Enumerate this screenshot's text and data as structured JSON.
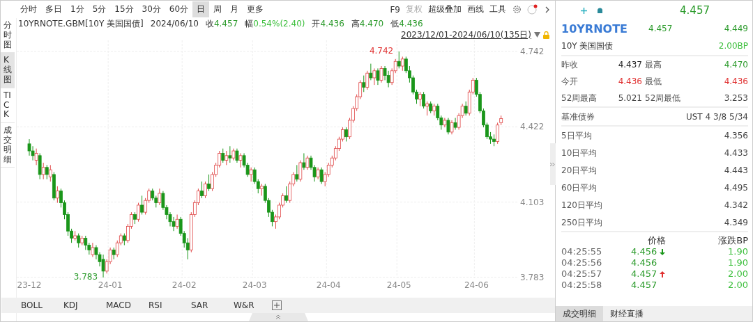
{
  "toolbar": {
    "periods": [
      {
        "label": "分时",
        "selected": false
      },
      {
        "label": "多日",
        "selected": false
      },
      {
        "label": "1分",
        "selected": false
      },
      {
        "label": "5分",
        "selected": false
      },
      {
        "label": "15分",
        "selected": false
      },
      {
        "label": "30分",
        "selected": false
      },
      {
        "label": "60分",
        "selected": false
      },
      {
        "label": "日",
        "selected": true
      },
      {
        "label": "周",
        "selected": false
      },
      {
        "label": "月",
        "selected": false
      },
      {
        "label": "更多",
        "selected": false
      }
    ],
    "tools": [
      {
        "label": "F9",
        "disabled": false
      },
      {
        "label": "复权",
        "disabled": true
      },
      {
        "label": "超级叠加",
        "disabled": false
      },
      {
        "label": "画线",
        "disabled": false
      },
      {
        "label": "工具",
        "disabled": false
      }
    ]
  },
  "side_tabs": [
    {
      "label": "分时图",
      "selected": false
    },
    {
      "label": "K线图",
      "selected": true
    },
    {
      "label": "TICK",
      "selected": false
    },
    {
      "label": "成交明细",
      "selected": false
    }
  ],
  "quote_line": {
    "symbol": "10YRNOTE.GBM[10Y 美国国债]",
    "date": "2024/06/10",
    "fields": [
      {
        "label": "收",
        "value": "4.457",
        "color": "#2a9a2a"
      },
      {
        "label": "幅",
        "value": "0.54%(2.40)",
        "color": "#3cbf3c"
      },
      {
        "label": "开",
        "value": "4.436",
        "color": "#2a9a2a"
      },
      {
        "label": "高",
        "value": "4.470",
        "color": "#2a9a2a"
      },
      {
        "label": "低",
        "value": "4.436",
        "color": "#2a9a2a"
      }
    ]
  },
  "range": "2023/12/01-2024/06/10(135日)",
  "chart_data": {
    "type": "candlestick",
    "ylim": [
      3.783,
      4.742
    ],
    "yticks": [
      {
        "value": 4.742,
        "label": "4.742"
      },
      {
        "value": 4.422,
        "label": "4.422"
      },
      {
        "value": 4.103,
        "label": "4.103"
      },
      {
        "value": 3.783,
        "label": "3.783"
      }
    ],
    "annotations": [
      "4.742",
      "3.783"
    ],
    "categories": [
      "23-12",
      null,
      null,
      null,
      null,
      null,
      null,
      null,
      null,
      null,
      null,
      null,
      null,
      null,
      null,
      null,
      null,
      null,
      null,
      null,
      null,
      null,
      null,
      "24-01",
      null,
      null,
      null,
      null,
      null,
      null,
      null,
      null,
      null,
      null,
      null,
      null,
      null,
      null,
      null,
      null,
      null,
      null,
      null,
      null,
      "24-02",
      null,
      null,
      null,
      null,
      null,
      null,
      null,
      null,
      null,
      null,
      null,
      null,
      null,
      null,
      null,
      null,
      null,
      null,
      null,
      "24-03",
      null,
      null,
      null,
      null,
      null,
      null,
      null,
      null,
      null,
      null,
      null,
      null,
      null,
      null,
      null,
      null,
      null,
      null,
      null,
      null,
      "24-04",
      null,
      null,
      null,
      null,
      null,
      null,
      null,
      null,
      null,
      null,
      null,
      null,
      null,
      null,
      null,
      null,
      null,
      null,
      null,
      "24-05",
      null,
      null,
      null,
      null,
      null,
      null,
      null,
      null,
      null,
      null,
      null,
      null,
      null,
      null,
      null,
      null,
      null,
      null,
      null,
      null,
      null,
      "24-06",
      null,
      null,
      null,
      null,
      null,
      null,
      null
    ],
    "ohlc": [
      [
        4.35,
        4.37,
        4.3,
        4.32
      ],
      [
        4.32,
        4.34,
        4.28,
        4.3
      ],
      [
        4.28,
        4.33,
        4.26,
        4.31
      ],
      [
        4.3,
        4.31,
        4.2,
        4.22
      ],
      [
        4.22,
        4.27,
        4.2,
        4.25
      ],
      [
        4.25,
        4.26,
        4.2,
        4.22
      ],
      [
        4.21,
        4.26,
        4.19,
        4.24
      ],
      [
        4.22,
        4.23,
        4.11,
        4.12
      ],
      [
        4.12,
        4.17,
        4.1,
        4.15
      ],
      [
        4.15,
        4.16,
        4.08,
        4.1
      ],
      [
        4.1,
        4.11,
        4.03,
        4.05
      ],
      [
        4.05,
        4.06,
        3.96,
        3.98
      ],
      [
        3.98,
        3.99,
        3.93,
        3.95
      ],
      [
        3.95,
        3.98,
        3.94,
        3.96
      ],
      [
        3.96,
        3.97,
        3.91,
        3.93
      ],
      [
        3.93,
        3.96,
        3.92,
        3.95
      ],
      [
        3.95,
        3.96,
        3.9,
        3.92
      ],
      [
        3.92,
        3.93,
        3.88,
        3.9
      ],
      [
        3.88,
        3.93,
        3.87,
        3.91
      ],
      [
        3.91,
        3.92,
        3.86,
        3.88
      ],
      [
        3.88,
        3.89,
        3.83,
        3.85
      ],
      [
        3.86,
        3.88,
        3.783,
        3.81
      ],
      [
        3.81,
        3.86,
        3.8,
        3.85
      ],
      [
        3.85,
        3.91,
        3.84,
        3.9
      ],
      [
        3.9,
        3.91,
        3.86,
        3.88
      ],
      [
        3.88,
        3.94,
        3.87,
        3.93
      ],
      [
        3.93,
        3.97,
        3.92,
        3.96
      ],
      [
        3.96,
        3.97,
        3.92,
        3.94
      ],
      [
        3.94,
        4.01,
        3.93,
        4.0
      ],
      [
        4.0,
        4.06,
        3.99,
        4.05
      ],
      [
        4.05,
        4.06,
        4.01,
        4.03
      ],
      [
        4.03,
        4.1,
        4.02,
        4.09
      ],
      [
        4.09,
        4.13,
        4.05,
        4.06
      ],
      [
        4.06,
        4.12,
        4.05,
        4.11
      ],
      [
        4.11,
        4.16,
        4.1,
        4.15
      ],
      [
        4.15,
        4.16,
        4.11,
        4.12
      ],
      [
        4.12,
        4.13,
        4.08,
        4.1
      ],
      [
        4.1,
        4.16,
        4.09,
        4.14
      ],
      [
        4.14,
        4.15,
        4.07,
        4.08
      ],
      [
        4.08,
        4.09,
        4.03,
        4.05
      ],
      [
        4.05,
        4.06,
        4.0,
        4.02
      ],
      [
        4.02,
        4.04,
        3.98,
        4.0
      ],
      [
        4.0,
        4.05,
        3.99,
        4.03
      ],
      [
        4.03,
        4.04,
        3.96,
        3.97
      ],
      [
        3.97,
        3.98,
        3.91,
        3.93
      ],
      [
        3.93,
        3.95,
        3.86,
        3.9
      ],
      [
        3.9,
        4.06,
        3.89,
        4.05
      ],
      [
        4.05,
        4.11,
        4.04,
        4.1
      ],
      [
        4.1,
        4.16,
        4.09,
        4.15
      ],
      [
        4.15,
        4.19,
        4.12,
        4.13
      ],
      [
        4.13,
        4.19,
        4.12,
        4.18
      ],
      [
        4.18,
        4.22,
        4.15,
        4.16
      ],
      [
        4.16,
        4.23,
        4.15,
        4.22
      ],
      [
        4.22,
        4.27,
        4.21,
        4.26
      ],
      [
        4.26,
        4.32,
        4.25,
        4.31
      ],
      [
        4.31,
        4.33,
        4.27,
        4.28
      ],
      [
        4.28,
        4.32,
        4.26,
        4.3
      ],
      [
        4.3,
        4.34,
        4.27,
        4.29
      ],
      [
        4.29,
        4.33,
        4.28,
        4.32
      ],
      [
        4.32,
        4.33,
        4.27,
        4.28
      ],
      [
        4.28,
        4.31,
        4.25,
        4.3
      ],
      [
        4.3,
        4.31,
        4.25,
        4.26
      ],
      [
        4.26,
        4.27,
        4.21,
        4.22
      ],
      [
        4.22,
        4.25,
        4.19,
        4.24
      ],
      [
        4.24,
        4.25,
        4.18,
        4.19
      ],
      [
        4.19,
        4.2,
        4.14,
        4.16
      ],
      [
        4.16,
        4.18,
        4.13,
        4.17
      ],
      [
        4.17,
        4.18,
        4.1,
        4.11
      ],
      [
        4.11,
        4.12,
        4.04,
        4.06
      ],
      [
        4.06,
        4.07,
        4.0,
        4.02
      ],
      [
        4.02,
        4.05,
        3.99,
        4.04
      ],
      [
        4.04,
        4.1,
        4.03,
        4.09
      ],
      [
        4.09,
        4.14,
        4.08,
        4.13
      ],
      [
        4.13,
        4.17,
        4.1,
        4.11
      ],
      [
        4.11,
        4.19,
        4.1,
        4.18
      ],
      [
        4.18,
        4.23,
        4.17,
        4.22
      ],
      [
        4.22,
        4.26,
        4.19,
        4.2
      ],
      [
        4.2,
        4.28,
        4.19,
        4.27
      ],
      [
        4.27,
        4.31,
        4.24,
        4.25
      ],
      [
        4.25,
        4.3,
        4.24,
        4.29
      ],
      [
        4.29,
        4.3,
        4.24,
        4.25
      ],
      [
        4.25,
        4.26,
        4.19,
        4.21
      ],
      [
        4.21,
        4.25,
        4.2,
        4.24
      ],
      [
        4.24,
        4.25,
        4.18,
        4.19
      ],
      [
        4.19,
        4.23,
        4.17,
        4.22
      ],
      [
        4.22,
        4.27,
        4.21,
        4.26
      ],
      [
        4.26,
        4.3,
        4.25,
        4.29
      ],
      [
        4.29,
        4.34,
        4.28,
        4.33
      ],
      [
        4.33,
        4.38,
        4.32,
        4.37
      ],
      [
        4.37,
        4.42,
        4.36,
        4.41
      ],
      [
        4.41,
        4.42,
        4.36,
        4.38
      ],
      [
        4.38,
        4.46,
        4.37,
        4.45
      ],
      [
        4.45,
        4.51,
        4.44,
        4.5
      ],
      [
        4.5,
        4.56,
        4.49,
        4.55
      ],
      [
        4.55,
        4.62,
        4.54,
        4.61
      ],
      [
        4.61,
        4.64,
        4.57,
        4.59
      ],
      [
        4.59,
        4.66,
        4.58,
        4.65
      ],
      [
        4.65,
        4.69,
        4.62,
        4.63
      ],
      [
        4.63,
        4.67,
        4.6,
        4.66
      ],
      [
        4.66,
        4.67,
        4.6,
        4.62
      ],
      [
        4.62,
        4.68,
        4.61,
        4.67
      ],
      [
        4.67,
        4.68,
        4.62,
        4.64
      ],
      [
        4.64,
        4.66,
        4.59,
        4.61
      ],
      [
        4.61,
        4.67,
        4.6,
        4.66
      ],
      [
        4.66,
        4.71,
        4.65,
        4.7
      ],
      [
        4.7,
        4.742,
        4.67,
        4.68
      ],
      [
        4.68,
        4.72,
        4.66,
        4.71
      ],
      [
        4.71,
        4.72,
        4.65,
        4.66
      ],
      [
        4.66,
        4.68,
        4.61,
        4.63
      ],
      [
        4.63,
        4.64,
        4.56,
        4.57
      ],
      [
        4.57,
        4.58,
        4.52,
        4.54
      ],
      [
        4.54,
        4.57,
        4.51,
        4.56
      ],
      [
        4.56,
        4.57,
        4.5,
        4.51
      ],
      [
        4.51,
        4.53,
        4.47,
        4.52
      ],
      [
        4.52,
        4.53,
        4.48,
        4.49
      ],
      [
        4.49,
        4.52,
        4.47,
        4.51
      ],
      [
        4.51,
        4.52,
        4.45,
        4.46
      ],
      [
        4.46,
        4.47,
        4.41,
        4.43
      ],
      [
        4.43,
        4.46,
        4.42,
        4.45
      ],
      [
        4.45,
        4.46,
        4.39,
        4.4
      ],
      [
        4.4,
        4.45,
        4.39,
        4.44
      ],
      [
        4.44,
        4.46,
        4.41,
        4.42
      ],
      [
        4.42,
        4.48,
        4.41,
        4.47
      ],
      [
        4.47,
        4.52,
        4.46,
        4.51
      ],
      [
        4.51,
        4.53,
        4.47,
        4.48
      ],
      [
        4.48,
        4.58,
        4.47,
        4.57
      ],
      [
        4.57,
        4.63,
        4.56,
        4.62
      ],
      [
        4.62,
        4.63,
        4.55,
        4.56
      ],
      [
        4.56,
        4.57,
        4.48,
        4.49
      ],
      [
        4.49,
        4.5,
        4.42,
        4.43
      ],
      [
        4.43,
        4.44,
        4.37,
        4.38
      ],
      [
        4.38,
        4.4,
        4.35,
        4.37
      ],
      [
        4.37,
        4.39,
        4.34,
        4.36
      ],
      [
        4.36,
        4.44,
        4.35,
        4.43
      ],
      [
        4.44,
        4.47,
        4.43,
        4.457
      ]
    ]
  },
  "indicators": [
    "BOLL",
    "KDJ",
    "MACD",
    "RSI",
    "SAR",
    "W&R"
  ],
  "panel": {
    "last": "4.457",
    "name": "10YRNOTE",
    "bid": "4.457",
    "ask": "4.449",
    "subtitle": "10Y 美国国债",
    "change": "2.00BP",
    "stats": [
      {
        "label": "昨收",
        "value": "4.437",
        "color": "#222222"
      },
      {
        "label": "最高",
        "value": "4.470",
        "color": "#2a9a2a"
      },
      {
        "label": "今开",
        "value": "4.436",
        "color": "#e03030"
      },
      {
        "label": "最低",
        "value": "4.436",
        "color": "#e03030"
      },
      {
        "label": "52周最高",
        "value": "5.021",
        "color": "#444444"
      },
      {
        "label": "52周最低",
        "value": "3.253",
        "color": "#444444"
      }
    ],
    "benchmark": {
      "label": "基准债券",
      "value": "UST 4 3/8 5/34"
    },
    "averages": [
      {
        "label": "5日平均",
        "value": "4.356"
      },
      {
        "label": "10日平均",
        "value": "4.433"
      },
      {
        "label": "20日平均",
        "value": "4.443"
      },
      {
        "label": "60日平均",
        "value": "4.495"
      },
      {
        "label": "120日平均",
        "value": "4.342"
      },
      {
        "label": "250日平均",
        "value": "4.349"
      }
    ],
    "ticks_header": {
      "price": "价格",
      "change": "涨跌BP"
    },
    "ticks": [
      {
        "time": "04:25:55",
        "price": "4.456",
        "falling": true,
        "rising": false,
        "change": "1.90"
      },
      {
        "time": "04:25:56",
        "price": "4.456",
        "falling": false,
        "rising": false,
        "change": "1.90"
      },
      {
        "time": "04:25:57",
        "price": "4.457",
        "falling": false,
        "rising": true,
        "change": "2.00"
      },
      {
        "time": "04:25:58",
        "price": "4.457",
        "falling": false,
        "rising": false,
        "change": "2.00"
      }
    ],
    "tabs": [
      {
        "label": "成交明细",
        "selected": true
      },
      {
        "label": "财经直播",
        "selected": false
      }
    ]
  }
}
